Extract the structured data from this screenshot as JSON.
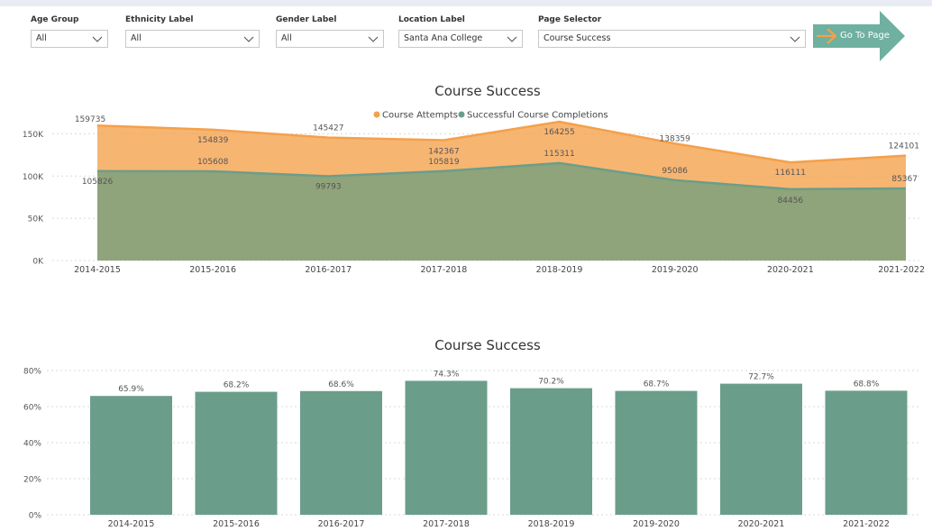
{
  "filters": [
    {
      "label": "Age Group",
      "value": "All"
    },
    {
      "label": "Ethnicity Label",
      "value": "All"
    },
    {
      "label": "Gender Label",
      "value": "All"
    },
    {
      "label": "Location Label",
      "value": "Santa Ana College"
    },
    {
      "label": "Page Selector",
      "value": "Course Success"
    }
  ],
  "go_button": {
    "label": "Go To Page"
  },
  "colors": {
    "attempts": "#f5a04a",
    "completions": "#6a9e8a",
    "bar": "#6a9e8a",
    "accent": "#6fb0a0"
  },
  "chart_data": [
    {
      "type": "area",
      "title": "Course Success",
      "legend": [
        "Course Attempts",
        "Successful Course Completions"
      ],
      "legend_position": "top-center",
      "categories": [
        "2014-2015",
        "2015-2016",
        "2016-2017",
        "2017-2018",
        "2018-2019",
        "2019-2020",
        "2020-2021",
        "2021-2022"
      ],
      "y_ticks": [
        "0K",
        "50K",
        "100K",
        "150K"
      ],
      "ylim": [
        0,
        160000
      ],
      "series": [
        {
          "name": "Course Attempts",
          "values": [
            159735,
            154839,
            145427,
            142367,
            164255,
            138359,
            116111,
            124101
          ],
          "labels": [
            "159735",
            "154839",
            "145427",
            "142367",
            "164255",
            "138359",
            "116111",
            "124101"
          ]
        },
        {
          "name": "Successful Course Completions",
          "values": [
            105826,
            105608,
            99793,
            105819,
            115311,
            95086,
            84456,
            85367
          ],
          "labels": [
            "105826",
            "105608",
            "99793",
            "105819",
            "115311",
            "95086",
            "84456",
            "85367"
          ]
        }
      ]
    },
    {
      "type": "bar",
      "title": "Course Success",
      "categories": [
        "2014-2015",
        "2015-2016",
        "2016-2017",
        "2017-2018",
        "2018-2019",
        "2019-2020",
        "2020-2021",
        "2021-2022"
      ],
      "values": [
        65.9,
        68.2,
        68.6,
        74.3,
        70.2,
        68.7,
        72.7,
        68.8
      ],
      "labels": [
        "65.9%",
        "68.2%",
        "68.6%",
        "74.3%",
        "70.2%",
        "68.7%",
        "72.7%",
        "68.8%"
      ],
      "y_ticks": [
        "0%",
        "20%",
        "40%",
        "60%",
        "80%"
      ],
      "ylim": [
        0,
        80
      ]
    }
  ]
}
